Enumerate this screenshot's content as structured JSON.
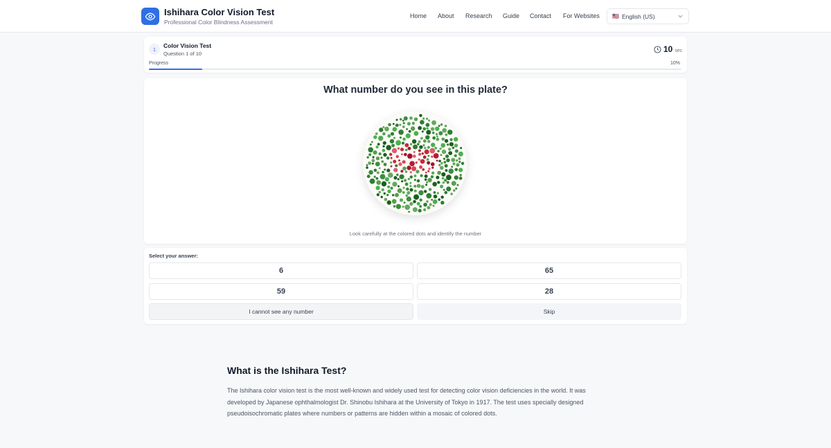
{
  "header": {
    "title": "Ishihara Color Vision Test",
    "subtitle": "Professional Color Blindness Assessment",
    "nav": [
      "Home",
      "About",
      "Research",
      "Guide",
      "Contact",
      "For Websites"
    ],
    "language": "English (US)",
    "language_flag": "🇺🇸"
  },
  "test": {
    "step": "1",
    "title": "Color Vision Test",
    "question_of": "Question 1 of 10",
    "timer_value": "10",
    "timer_unit": "sec",
    "progress_label": "Progress",
    "progress_text": "10%",
    "progress_fraction": 0.1
  },
  "plate": {
    "question": "What number do you see in this plate?",
    "hint": "Look carefully at the colored dots and identify the number"
  },
  "answers": {
    "label": "Select your answer:",
    "options": [
      "6",
      "65",
      "59",
      "28"
    ],
    "cannot_see": "I cannot see any number",
    "skip": "Skip"
  },
  "info": {
    "title": "What is the Ishihara Test?",
    "text": "The Ishihara color vision test is the most well-known and widely used test for detecting color vision deficiencies in the world. It was developed by Japanese ophthalmologist Dr. Shinobu Ishihara at the University of Tokyo in 1917. The test uses specially designed pseudoisochromatic plates where numbers or patterns are hidden within a mosaic of colored dots."
  },
  "colors": {
    "accent": "#2f6fe4",
    "plate_green": [
      "#2e7d32",
      "#3c8d40",
      "#4caf50",
      "#66a861",
      "#1b5e20",
      "#5b9e4f"
    ],
    "plate_red": [
      "#c62839",
      "#d94458",
      "#b71c33",
      "#e05a6d",
      "#a3132b"
    ]
  }
}
